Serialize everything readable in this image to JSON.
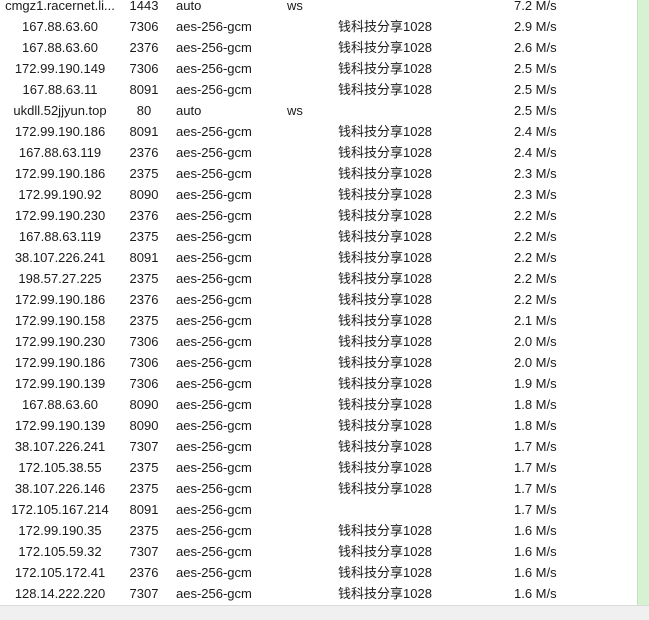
{
  "colors": {
    "background": "#ffffff",
    "speed_stripe": "#d7f2d3",
    "scrollbar": "#f0f0f0"
  },
  "rows": [
    {
      "address": "cmgz1.racernet.li...",
      "port": "1443",
      "security": "auto",
      "network": "ws",
      "remarks": "",
      "speed": "7.2 M/s"
    },
    {
      "address": "167.88.63.60",
      "port": "7306",
      "security": "aes-256-gcm",
      "network": "",
      "remarks": "钱科技分享1028",
      "speed": "2.9 M/s"
    },
    {
      "address": "167.88.63.60",
      "port": "2376",
      "security": "aes-256-gcm",
      "network": "",
      "remarks": "钱科技分享1028",
      "speed": "2.6 M/s"
    },
    {
      "address": "172.99.190.149",
      "port": "7306",
      "security": "aes-256-gcm",
      "network": "",
      "remarks": "钱科技分享1028",
      "speed": "2.5 M/s"
    },
    {
      "address": "167.88.63.11",
      "port": "8091",
      "security": "aes-256-gcm",
      "network": "",
      "remarks": "钱科技分享1028",
      "speed": "2.5 M/s"
    },
    {
      "address": "ukdll.52jjyun.top",
      "port": "80",
      "security": "auto",
      "network": "ws",
      "remarks": "",
      "speed": "2.5 M/s"
    },
    {
      "address": "172.99.190.186",
      "port": "8091",
      "security": "aes-256-gcm",
      "network": "",
      "remarks": "钱科技分享1028",
      "speed": "2.4 M/s"
    },
    {
      "address": "167.88.63.119",
      "port": "2376",
      "security": "aes-256-gcm",
      "network": "",
      "remarks": "钱科技分享1028",
      "speed": "2.4 M/s"
    },
    {
      "address": "172.99.190.186",
      "port": "2375",
      "security": "aes-256-gcm",
      "network": "",
      "remarks": "钱科技分享1028",
      "speed": "2.3 M/s"
    },
    {
      "address": "172.99.190.92",
      "port": "8090",
      "security": "aes-256-gcm",
      "network": "",
      "remarks": "钱科技分享1028",
      "speed": "2.3 M/s"
    },
    {
      "address": "172.99.190.230",
      "port": "2376",
      "security": "aes-256-gcm",
      "network": "",
      "remarks": "钱科技分享1028",
      "speed": "2.2 M/s"
    },
    {
      "address": "167.88.63.119",
      "port": "2375",
      "security": "aes-256-gcm",
      "network": "",
      "remarks": "钱科技分享1028",
      "speed": "2.2 M/s"
    },
    {
      "address": "38.107.226.241",
      "port": "8091",
      "security": "aes-256-gcm",
      "network": "",
      "remarks": "钱科技分享1028",
      "speed": "2.2 M/s"
    },
    {
      "address": "198.57.27.225",
      "port": "2375",
      "security": "aes-256-gcm",
      "network": "",
      "remarks": "钱科技分享1028",
      "speed": "2.2 M/s"
    },
    {
      "address": "172.99.190.186",
      "port": "2376",
      "security": "aes-256-gcm",
      "network": "",
      "remarks": "钱科技分享1028",
      "speed": "2.2 M/s"
    },
    {
      "address": "172.99.190.158",
      "port": "2375",
      "security": "aes-256-gcm",
      "network": "",
      "remarks": "钱科技分享1028",
      "speed": "2.1 M/s"
    },
    {
      "address": "172.99.190.230",
      "port": "7306",
      "security": "aes-256-gcm",
      "network": "",
      "remarks": "钱科技分享1028",
      "speed": "2.0 M/s"
    },
    {
      "address": "172.99.190.186",
      "port": "7306",
      "security": "aes-256-gcm",
      "network": "",
      "remarks": "钱科技分享1028",
      "speed": "2.0 M/s"
    },
    {
      "address": "172.99.190.139",
      "port": "7306",
      "security": "aes-256-gcm",
      "network": "",
      "remarks": "钱科技分享1028",
      "speed": "1.9 M/s"
    },
    {
      "address": "167.88.63.60",
      "port": "8090",
      "security": "aes-256-gcm",
      "network": "",
      "remarks": "钱科技分享1028",
      "speed": "1.8 M/s"
    },
    {
      "address": "172.99.190.139",
      "port": "8090",
      "security": "aes-256-gcm",
      "network": "",
      "remarks": "钱科技分享1028",
      "speed": "1.8 M/s"
    },
    {
      "address": "38.107.226.241",
      "port": "7307",
      "security": "aes-256-gcm",
      "network": "",
      "remarks": "钱科技分享1028",
      "speed": "1.7 M/s"
    },
    {
      "address": "172.105.38.55",
      "port": "2375",
      "security": "aes-256-gcm",
      "network": "",
      "remarks": "钱科技分享1028",
      "speed": "1.7 M/s"
    },
    {
      "address": "38.107.226.146",
      "port": "2375",
      "security": "aes-256-gcm",
      "network": "",
      "remarks": "钱科技分享1028",
      "speed": "1.7 M/s"
    },
    {
      "address": "172.105.167.214",
      "port": "8091",
      "security": "aes-256-gcm",
      "network": "",
      "remarks": "",
      "speed": "1.7 M/s"
    },
    {
      "address": "172.99.190.35",
      "port": "2375",
      "security": "aes-256-gcm",
      "network": "",
      "remarks": "钱科技分享1028",
      "speed": "1.6 M/s"
    },
    {
      "address": "172.105.59.32",
      "port": "7307",
      "security": "aes-256-gcm",
      "network": "",
      "remarks": "钱科技分享1028",
      "speed": "1.6 M/s"
    },
    {
      "address": "172.105.172.41",
      "port": "2376",
      "security": "aes-256-gcm",
      "network": "",
      "remarks": "钱科技分享1028",
      "speed": "1.6 M/s"
    },
    {
      "address": "128.14.222.220",
      "port": "7307",
      "security": "aes-256-gcm",
      "network": "",
      "remarks": "钱科技分享1028",
      "speed": "1.6 M/s"
    }
  ]
}
